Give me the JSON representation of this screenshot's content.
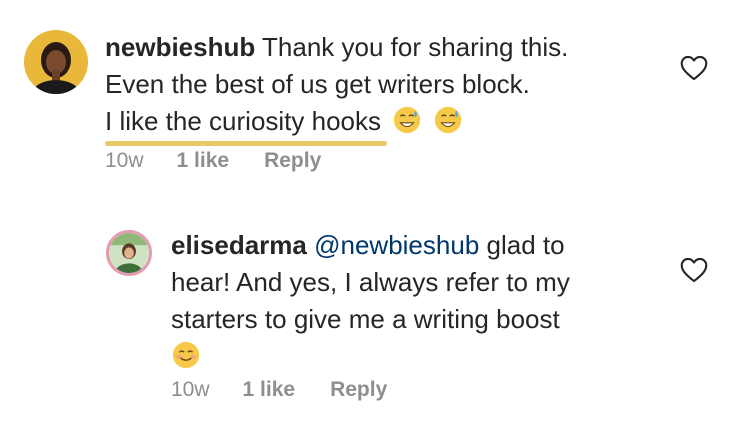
{
  "comments": [
    {
      "username": "newbieshub",
      "lines": [
        "Thank you for sharing this.",
        "Even the best of us get writers block.",
        "I like the curiosity hooks"
      ],
      "emojis": [
        "grinning-sweat-emoji",
        "grinning-sweat-emoji"
      ],
      "time": "10w",
      "likes": "1 like",
      "reply": "Reply"
    },
    {
      "username": "elisedarma",
      "mention": "@newbieshub",
      "lines": [
        "glad to",
        "hear! And yes, I always refer to my",
        "starters to give me a writing boost"
      ],
      "emojis": [
        "smiling-blush-emoji"
      ],
      "time": "10w",
      "likes": "1 like",
      "reply": "Reply"
    }
  ],
  "colors": {
    "text": "#262626",
    "meta": "#8e8e8e",
    "mention": "#00376b",
    "highlight": "#e7c766"
  }
}
